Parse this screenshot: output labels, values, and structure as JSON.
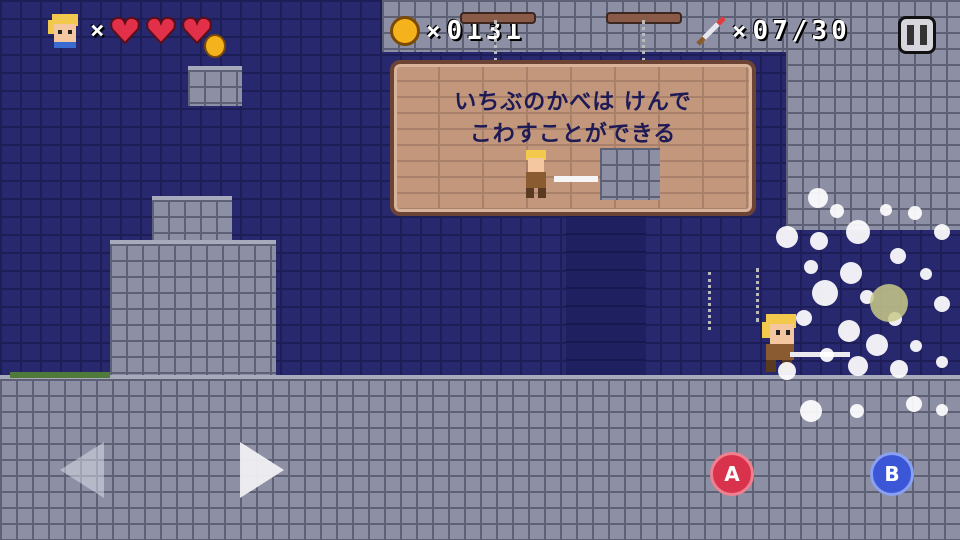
{
  "hud": {
    "player_icon": "hero-face-icon",
    "lives_multiplier": "×",
    "hearts_full": 3,
    "coin_icon": "coin-icon",
    "coin_multiplier": "×",
    "coin_count": "0131",
    "sword_icon": "sword-icon",
    "sword_multiplier": "×",
    "sword_count": "07/30",
    "pause_icon": "pause-icon"
  },
  "sign": {
    "line1": "いちぶのかべは けんで",
    "line2": "こわすことができる"
  },
  "controls": {
    "left_icon": "arrow-left-icon",
    "right_icon": "arrow-right-icon",
    "a_label": "A",
    "b_label": "B"
  },
  "colors": {
    "background_blue": "#27286e",
    "stone_gray": "#8d90a4",
    "sign_wood": "#c2977c",
    "heart_red": "#e2304a",
    "coin_gold": "#f4b21c",
    "button_a": "#d8324c",
    "button_b": "#3c56d8"
  }
}
